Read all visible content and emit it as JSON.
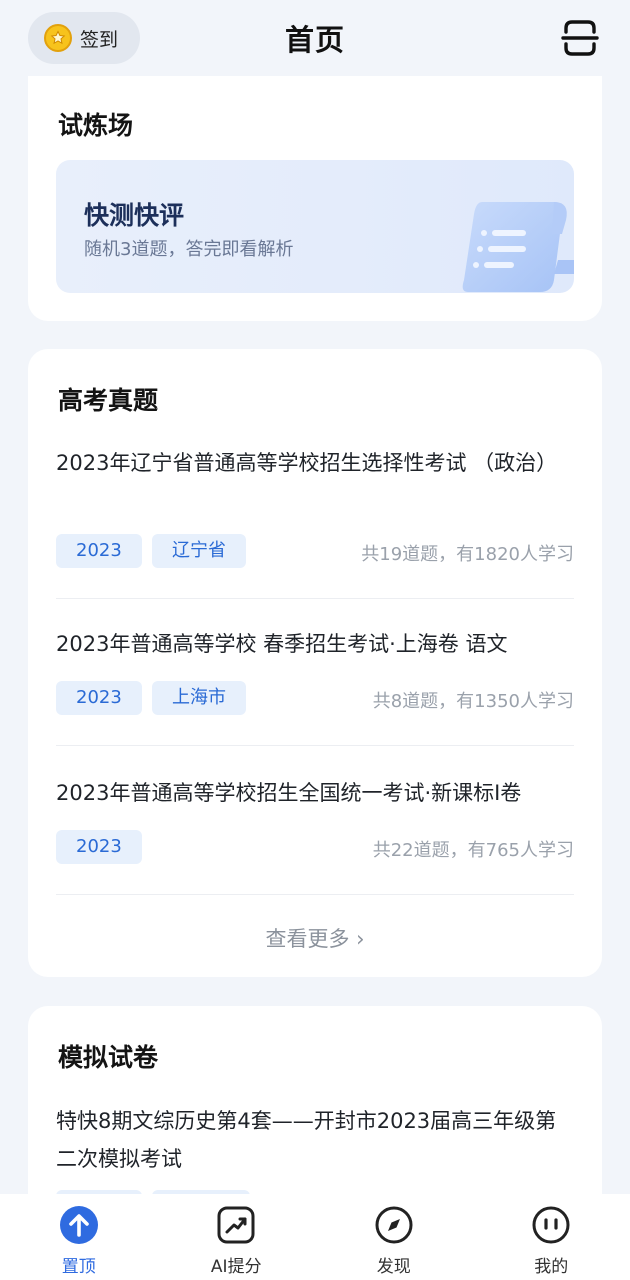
{
  "header": {
    "checkin_label": "签到",
    "title": "首页"
  },
  "practice": {
    "title": "试炼场",
    "quick_title": "快测快评",
    "quick_sub": "随机3道题，答完即看解析"
  },
  "exams": {
    "title": "高考真题",
    "items": [
      {
        "title": "2023年辽宁省普通高等学校招生选择性考试 （政治）",
        "tags": [
          "2023",
          "辽宁省"
        ],
        "stats": "共19道题，有1820人学习"
      },
      {
        "title": "2023年普通高等学校 春季招生考试·上海卷 语文",
        "tags": [
          "2023",
          "上海市"
        ],
        "stats": "共8道题，有1350人学习"
      },
      {
        "title": "2023年普通高等学校招生全国统一考试·新课标I卷",
        "tags": [
          "2023"
        ],
        "stats": "共22道题，有765人学习"
      }
    ],
    "more_label": "查看更多 ›"
  },
  "mock": {
    "title": "模拟试卷",
    "item_title": "特快8期文综历史第4套——开封市2023届高三年级第二次模拟考试"
  },
  "nav": {
    "items": [
      {
        "label": "置顶",
        "icon": "arrow-up-icon",
        "active": true
      },
      {
        "label": "AI提分",
        "icon": "chart-trend-icon",
        "active": false
      },
      {
        "label": "发现",
        "icon": "compass-icon",
        "active": false
      },
      {
        "label": "我的",
        "icon": "face-icon",
        "active": false
      }
    ]
  },
  "colors": {
    "accent": "#2f6be0",
    "tag_bg": "#e7f0fc",
    "tag_text": "#2a6ad5",
    "page_bg": "#f2f5fa"
  }
}
